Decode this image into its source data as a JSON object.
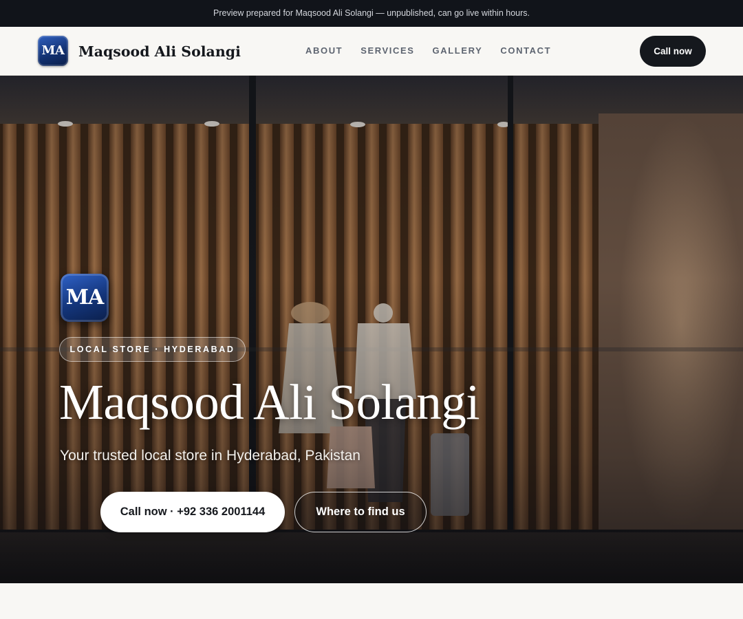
{
  "preview_bar": {
    "text": "Preview prepared for Maqsood Ali Solangi — unpublished, can go live within hours."
  },
  "header": {
    "logo_initials": "MA",
    "brand_name": "Maqsood Ali Solangi",
    "nav": [
      {
        "label": "ABOUT"
      },
      {
        "label": "SERVICES"
      },
      {
        "label": "GALLERY"
      },
      {
        "label": "CONTACT"
      }
    ],
    "call_button": "Call now"
  },
  "hero": {
    "badge_initials": "MA",
    "category_pill": "LOCAL STORE · HYDERABAD",
    "title": "Maqsood Ali Solangi",
    "subtitle": "Your trusted local store in Hyderabad, Pakistan",
    "primary_button": "Call now · +92 336 2001144",
    "secondary_button": "Where to find us",
    "background_image": "storefront-window-mannequins"
  },
  "colors": {
    "dark": "#15181d",
    "preview_bar": "#11141a",
    "page_bg": "#f8f7f4",
    "brand_blue": "#14357a",
    "nav_text": "#5d6470"
  }
}
